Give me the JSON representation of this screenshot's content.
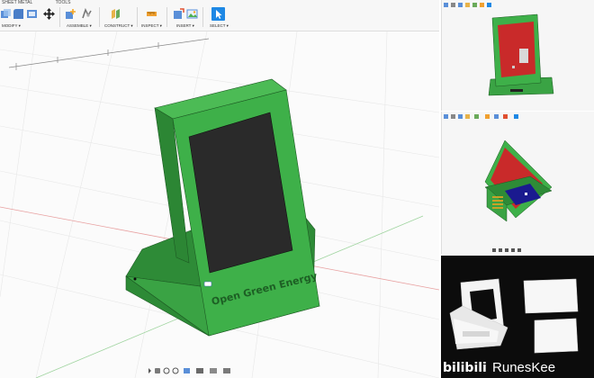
{
  "toolbar": {
    "tabs": [
      "SHEET METAL",
      "TOOLS"
    ],
    "groups": {
      "modify": "MODIFY ▾",
      "assemble": "ASSEMBLE ▾",
      "construct": "CONSTRUCT ▾",
      "inspect": "INSPECT ▾",
      "insert": "INSERT ▾",
      "select": "SELECT ▾"
    }
  },
  "model": {
    "engraving": "Open Green Energy",
    "body_color": "#3eb049",
    "screen_color": "#2a2a2a",
    "panel_color": "#c92a2a"
  },
  "watermark": {
    "logo": "bilibili",
    "name": "RunesKee"
  },
  "colors": {
    "accent": "#1e88e5",
    "grid_red": "#e05050",
    "grid_green": "#4caf50"
  }
}
